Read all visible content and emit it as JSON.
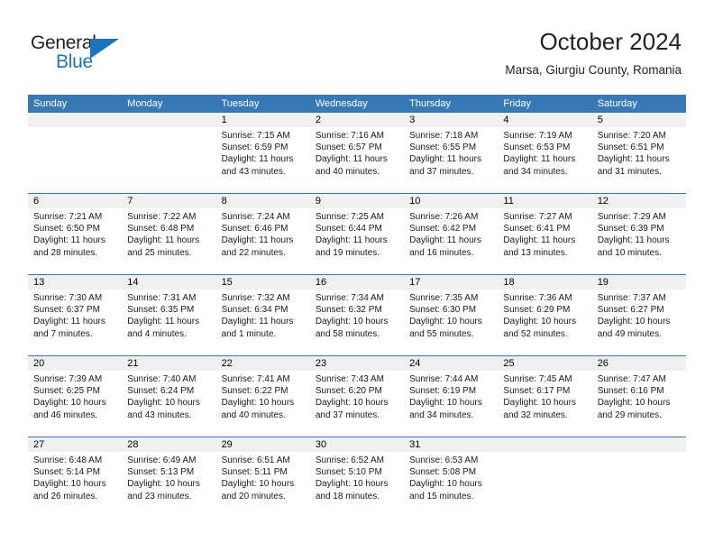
{
  "brand": {
    "name_top": "General",
    "name_bottom": "Blue",
    "accent_color": "#1b75bb"
  },
  "header": {
    "title": "October 2024",
    "location": "Marsa, Giurgiu County, Romania"
  },
  "theme": {
    "header_blue": "#3878b4",
    "daynum_band": "#f0f0f0",
    "text": "#1a1a1a"
  },
  "weekdays": [
    "Sunday",
    "Monday",
    "Tuesday",
    "Wednesday",
    "Thursday",
    "Friday",
    "Saturday"
  ],
  "weeks": [
    [
      {
        "day": "",
        "sunrise": "",
        "sunset": "",
        "daylight1": "",
        "daylight2": ""
      },
      {
        "day": "",
        "sunrise": "",
        "sunset": "",
        "daylight1": "",
        "daylight2": ""
      },
      {
        "day": "1",
        "sunrise": "Sunrise: 7:15 AM",
        "sunset": "Sunset: 6:59 PM",
        "daylight1": "Daylight: 11 hours",
        "daylight2": "and 43 minutes."
      },
      {
        "day": "2",
        "sunrise": "Sunrise: 7:16 AM",
        "sunset": "Sunset: 6:57 PM",
        "daylight1": "Daylight: 11 hours",
        "daylight2": "and 40 minutes."
      },
      {
        "day": "3",
        "sunrise": "Sunrise: 7:18 AM",
        "sunset": "Sunset: 6:55 PM",
        "daylight1": "Daylight: 11 hours",
        "daylight2": "and 37 minutes."
      },
      {
        "day": "4",
        "sunrise": "Sunrise: 7:19 AM",
        "sunset": "Sunset: 6:53 PM",
        "daylight1": "Daylight: 11 hours",
        "daylight2": "and 34 minutes."
      },
      {
        "day": "5",
        "sunrise": "Sunrise: 7:20 AM",
        "sunset": "Sunset: 6:51 PM",
        "daylight1": "Daylight: 11 hours",
        "daylight2": "and 31 minutes."
      }
    ],
    [
      {
        "day": "6",
        "sunrise": "Sunrise: 7:21 AM",
        "sunset": "Sunset: 6:50 PM",
        "daylight1": "Daylight: 11 hours",
        "daylight2": "and 28 minutes."
      },
      {
        "day": "7",
        "sunrise": "Sunrise: 7:22 AM",
        "sunset": "Sunset: 6:48 PM",
        "daylight1": "Daylight: 11 hours",
        "daylight2": "and 25 minutes."
      },
      {
        "day": "8",
        "sunrise": "Sunrise: 7:24 AM",
        "sunset": "Sunset: 6:46 PM",
        "daylight1": "Daylight: 11 hours",
        "daylight2": "and 22 minutes."
      },
      {
        "day": "9",
        "sunrise": "Sunrise: 7:25 AM",
        "sunset": "Sunset: 6:44 PM",
        "daylight1": "Daylight: 11 hours",
        "daylight2": "and 19 minutes."
      },
      {
        "day": "10",
        "sunrise": "Sunrise: 7:26 AM",
        "sunset": "Sunset: 6:42 PM",
        "daylight1": "Daylight: 11 hours",
        "daylight2": "and 16 minutes."
      },
      {
        "day": "11",
        "sunrise": "Sunrise: 7:27 AM",
        "sunset": "Sunset: 6:41 PM",
        "daylight1": "Daylight: 11 hours",
        "daylight2": "and 13 minutes."
      },
      {
        "day": "12",
        "sunrise": "Sunrise: 7:29 AM",
        "sunset": "Sunset: 6:39 PM",
        "daylight1": "Daylight: 11 hours",
        "daylight2": "and 10 minutes."
      }
    ],
    [
      {
        "day": "13",
        "sunrise": "Sunrise: 7:30 AM",
        "sunset": "Sunset: 6:37 PM",
        "daylight1": "Daylight: 11 hours",
        "daylight2": "and 7 minutes."
      },
      {
        "day": "14",
        "sunrise": "Sunrise: 7:31 AM",
        "sunset": "Sunset: 6:35 PM",
        "daylight1": "Daylight: 11 hours",
        "daylight2": "and 4 minutes."
      },
      {
        "day": "15",
        "sunrise": "Sunrise: 7:32 AM",
        "sunset": "Sunset: 6:34 PM",
        "daylight1": "Daylight: 11 hours",
        "daylight2": "and 1 minute."
      },
      {
        "day": "16",
        "sunrise": "Sunrise: 7:34 AM",
        "sunset": "Sunset: 6:32 PM",
        "daylight1": "Daylight: 10 hours",
        "daylight2": "and 58 minutes."
      },
      {
        "day": "17",
        "sunrise": "Sunrise: 7:35 AM",
        "sunset": "Sunset: 6:30 PM",
        "daylight1": "Daylight: 10 hours",
        "daylight2": "and 55 minutes."
      },
      {
        "day": "18",
        "sunrise": "Sunrise: 7:36 AM",
        "sunset": "Sunset: 6:29 PM",
        "daylight1": "Daylight: 10 hours",
        "daylight2": "and 52 minutes."
      },
      {
        "day": "19",
        "sunrise": "Sunrise: 7:37 AM",
        "sunset": "Sunset: 6:27 PM",
        "daylight1": "Daylight: 10 hours",
        "daylight2": "and 49 minutes."
      }
    ],
    [
      {
        "day": "20",
        "sunrise": "Sunrise: 7:39 AM",
        "sunset": "Sunset: 6:25 PM",
        "daylight1": "Daylight: 10 hours",
        "daylight2": "and 46 minutes."
      },
      {
        "day": "21",
        "sunrise": "Sunrise: 7:40 AM",
        "sunset": "Sunset: 6:24 PM",
        "daylight1": "Daylight: 10 hours",
        "daylight2": "and 43 minutes."
      },
      {
        "day": "22",
        "sunrise": "Sunrise: 7:41 AM",
        "sunset": "Sunset: 6:22 PM",
        "daylight1": "Daylight: 10 hours",
        "daylight2": "and 40 minutes."
      },
      {
        "day": "23",
        "sunrise": "Sunrise: 7:43 AM",
        "sunset": "Sunset: 6:20 PM",
        "daylight1": "Daylight: 10 hours",
        "daylight2": "and 37 minutes."
      },
      {
        "day": "24",
        "sunrise": "Sunrise: 7:44 AM",
        "sunset": "Sunset: 6:19 PM",
        "daylight1": "Daylight: 10 hours",
        "daylight2": "and 34 minutes."
      },
      {
        "day": "25",
        "sunrise": "Sunrise: 7:45 AM",
        "sunset": "Sunset: 6:17 PM",
        "daylight1": "Daylight: 10 hours",
        "daylight2": "and 32 minutes."
      },
      {
        "day": "26",
        "sunrise": "Sunrise: 7:47 AM",
        "sunset": "Sunset: 6:16 PM",
        "daylight1": "Daylight: 10 hours",
        "daylight2": "and 29 minutes."
      }
    ],
    [
      {
        "day": "27",
        "sunrise": "Sunrise: 6:48 AM",
        "sunset": "Sunset: 5:14 PM",
        "daylight1": "Daylight: 10 hours",
        "daylight2": "and 26 minutes."
      },
      {
        "day": "28",
        "sunrise": "Sunrise: 6:49 AM",
        "sunset": "Sunset: 5:13 PM",
        "daylight1": "Daylight: 10 hours",
        "daylight2": "and 23 minutes."
      },
      {
        "day": "29",
        "sunrise": "Sunrise: 6:51 AM",
        "sunset": "Sunset: 5:11 PM",
        "daylight1": "Daylight: 10 hours",
        "daylight2": "and 20 minutes."
      },
      {
        "day": "30",
        "sunrise": "Sunrise: 6:52 AM",
        "sunset": "Sunset: 5:10 PM",
        "daylight1": "Daylight: 10 hours",
        "daylight2": "and 18 minutes."
      },
      {
        "day": "31",
        "sunrise": "Sunrise: 6:53 AM",
        "sunset": "Sunset: 5:08 PM",
        "daylight1": "Daylight: 10 hours",
        "daylight2": "and 15 minutes."
      },
      {
        "day": "",
        "sunrise": "",
        "sunset": "",
        "daylight1": "",
        "daylight2": ""
      },
      {
        "day": "",
        "sunrise": "",
        "sunset": "",
        "daylight1": "",
        "daylight2": ""
      }
    ]
  ]
}
